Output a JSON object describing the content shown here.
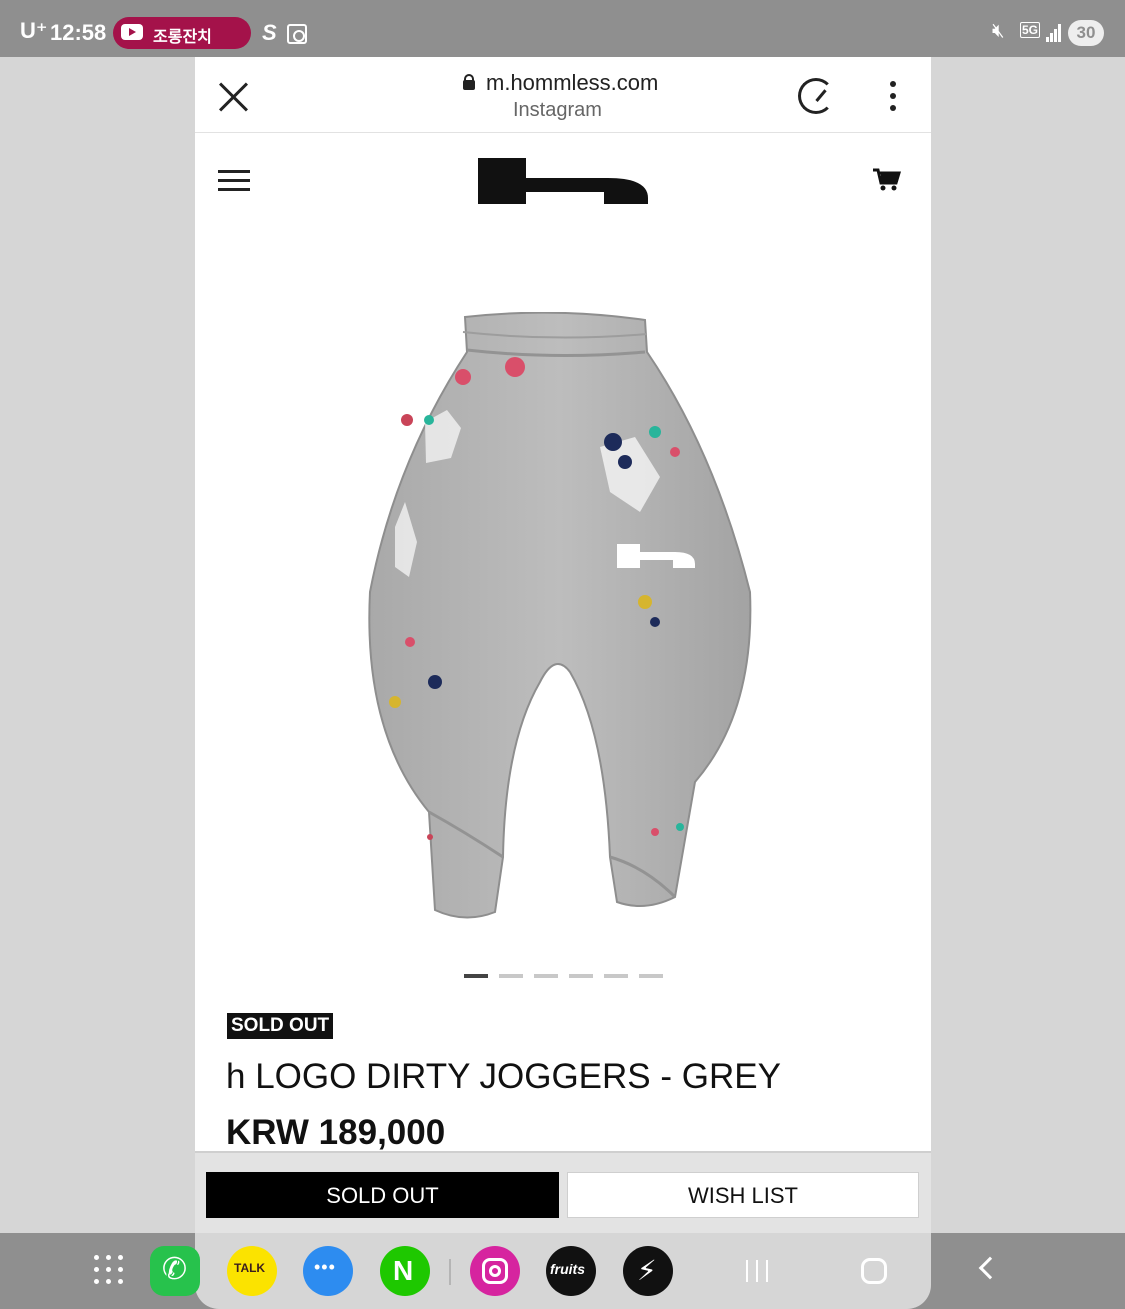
{
  "status_bar": {
    "carrier": "U⁺",
    "time": "12:58",
    "notification_pill": "조롱잔치",
    "s_glyph": "S",
    "network_badge": "5G",
    "battery": "30",
    "icons": [
      "youtube-icon",
      "samsung-pass-icon",
      "camera-icon",
      "mute-icon",
      "signal-icon",
      "battery-icon"
    ]
  },
  "browser": {
    "url": "m.hommless.com",
    "subtitle": "Instagram",
    "icons": [
      "close-icon",
      "lock-icon",
      "speed-icon",
      "more-icon"
    ]
  },
  "site": {
    "logo_alt": "h",
    "icons": [
      "menu-icon",
      "cart-icon"
    ]
  },
  "product": {
    "status_badge": "SOLD OUT",
    "title": "h LOGO DIRTY JOGGERS - GREY",
    "price": "KRW 189,000",
    "image_count": 6,
    "active_image": 1
  },
  "actions": {
    "primary_label": "SOLD OUT",
    "secondary_label": "WISH LIST"
  },
  "dock": {
    "apps": [
      {
        "name": "phone-app-icon"
      },
      {
        "name": "kakaotalk-app-icon",
        "label": "TALK"
      },
      {
        "name": "messages-app-icon"
      },
      {
        "name": "naver-app-icon",
        "label": "N"
      },
      {
        "name": "instagram-app-icon"
      },
      {
        "name": "fruits-app-icon",
        "label": "fruits"
      },
      {
        "name": "bolt-app-icon"
      }
    ],
    "nav": [
      "recent-apps-button",
      "home-button",
      "back-button"
    ]
  },
  "colors": {
    "status_bar_bg": "#8f8f8f",
    "notification_pill": "#a4124a",
    "sold_out_button_bg": "#000000",
    "page_bg": "#ffffff"
  }
}
